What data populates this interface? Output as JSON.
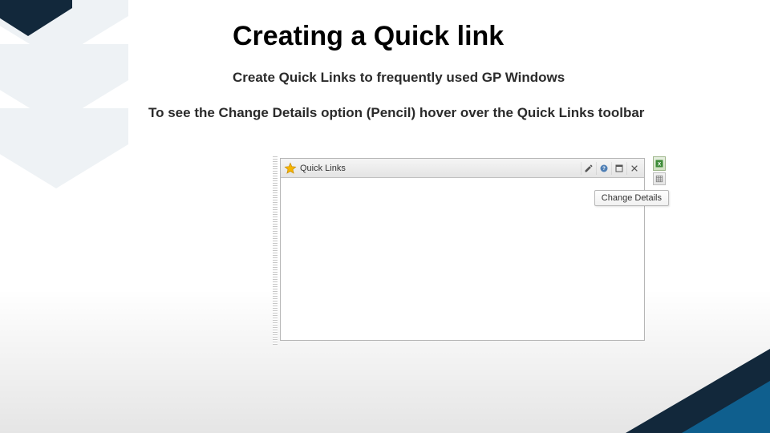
{
  "slide": {
    "title": "Creating a Quick link",
    "subtitle": "Create Quick Links to frequently used GP Windows",
    "instruction": "To see the Change Details option (Pencil) hover over the Quick Links toolbar"
  },
  "quicklinks": {
    "panel_title": "Quick Links",
    "tooltip": "Change Details"
  },
  "icons": {
    "star": "star-icon",
    "pencil": "pencil-icon",
    "help": "help-icon",
    "expand": "expand-icon",
    "close": "close-icon",
    "excel": "excel-icon",
    "grid": "grid-icon"
  },
  "colors": {
    "chevron": "#eef2f5",
    "accent_dark": "#12283b",
    "accent_blue": "#0f5f8e",
    "star_fill": "#f5b400",
    "excel_green": "#3d8b37"
  }
}
